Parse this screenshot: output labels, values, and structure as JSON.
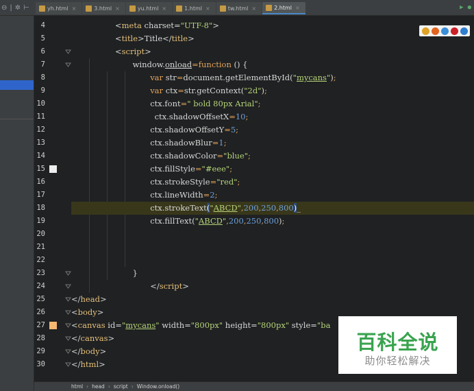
{
  "tabs": [
    {
      "label": "yh.html",
      "active": false
    },
    {
      "label": "3.html",
      "active": false
    },
    {
      "label": "yu.html",
      "active": false
    },
    {
      "label": "1.html",
      "active": false
    },
    {
      "label": "tw.html",
      "active": false
    },
    {
      "label": "2.html",
      "active": true
    }
  ],
  "gutter": {
    "line_numbers": [
      "4",
      "5",
      "6",
      "7",
      "8",
      "9",
      "10",
      "11",
      "12",
      "13",
      "14",
      "15",
      "16",
      "17",
      "18",
      "19",
      "20",
      "21",
      "22",
      "23",
      "24",
      "25",
      "26",
      "27",
      "28",
      "29",
      "30"
    ]
  },
  "code": {
    "lines": [
      {
        "indent": 10,
        "tokens": [
          {
            "t": "<",
            "c": "plain"
          },
          {
            "t": "meta",
            "c": "tag"
          },
          {
            "t": " charset=",
            "c": "plain"
          },
          {
            "t": "\"UTF-8\"",
            "c": "str"
          },
          {
            "t": ">",
            "c": "plain"
          }
        ]
      },
      {
        "indent": 10,
        "tokens": [
          {
            "t": "<",
            "c": "plain"
          },
          {
            "t": "title",
            "c": "tag"
          },
          {
            "t": ">Title</",
            "c": "plain"
          },
          {
            "t": "title",
            "c": "tag"
          },
          {
            "t": ">",
            "c": "plain"
          }
        ]
      },
      {
        "indent": 10,
        "tokens": [
          {
            "t": "<",
            "c": "plain"
          },
          {
            "t": "script",
            "c": "tag"
          },
          {
            "t": ">",
            "c": "plain"
          }
        ]
      },
      {
        "indent": 14,
        "tokens": [
          {
            "t": "window.",
            "c": "plain"
          },
          {
            "t": "onload",
            "c": "plain ul"
          },
          {
            "t": "=",
            "c": "op"
          },
          {
            "t": "function",
            "c": "kw"
          },
          {
            "t": " () {",
            "c": "plain"
          }
        ]
      },
      {
        "indent": 18,
        "tokens": [
          {
            "t": "var",
            "c": "kw"
          },
          {
            "t": " str",
            "c": "plain"
          },
          {
            "t": "=",
            "c": "op"
          },
          {
            "t": "document.getElementById(",
            "c": "plain"
          },
          {
            "t": "\"",
            "c": "str"
          },
          {
            "t": "mycans",
            "c": "str ul"
          },
          {
            "t": "\"",
            "c": "str"
          },
          {
            "t": ")",
            "c": "plain"
          },
          {
            "t": ";",
            "c": "op"
          }
        ]
      },
      {
        "indent": 18,
        "tokens": [
          {
            "t": "var",
            "c": "kw"
          },
          {
            "t": " ctx",
            "c": "plain"
          },
          {
            "t": "=",
            "c": "op"
          },
          {
            "t": "str.getContext(",
            "c": "plain"
          },
          {
            "t": "\"2d\"",
            "c": "str"
          },
          {
            "t": ")",
            "c": "plain"
          },
          {
            "t": ";",
            "c": "op"
          }
        ]
      },
      {
        "indent": 18,
        "tokens": [
          {
            "t": "ctx.font",
            "c": "plain"
          },
          {
            "t": "=",
            "c": "op"
          },
          {
            "t": "\" bold 80px Arial\"",
            "c": "str"
          },
          {
            "t": ";",
            "c": "op"
          }
        ]
      },
      {
        "indent": 19,
        "tokens": [
          {
            "t": "ctx.shadowOffsetX",
            "c": "plain"
          },
          {
            "t": "=",
            "c": "op"
          },
          {
            "t": "10",
            "c": "num"
          },
          {
            "t": ";",
            "c": "op"
          }
        ]
      },
      {
        "indent": 18,
        "tokens": [
          {
            "t": "ctx.shadowOffsetY",
            "c": "plain"
          },
          {
            "t": "=",
            "c": "op"
          },
          {
            "t": "5",
            "c": "num"
          },
          {
            "t": ";",
            "c": "op"
          }
        ]
      },
      {
        "indent": 18,
        "tokens": [
          {
            "t": "ctx.shadowBlur",
            "c": "plain"
          },
          {
            "t": "=",
            "c": "op"
          },
          {
            "t": "1",
            "c": "num"
          },
          {
            "t": ";",
            "c": "op"
          }
        ]
      },
      {
        "indent": 18,
        "tokens": [
          {
            "t": "ctx.shadowColor",
            "c": "plain"
          },
          {
            "t": "=",
            "c": "op"
          },
          {
            "t": "\"blue\"",
            "c": "str"
          },
          {
            "t": ";",
            "c": "op"
          }
        ]
      },
      {
        "indent": 18,
        "tokens": [
          {
            "t": "ctx.fillStyle",
            "c": "plain"
          },
          {
            "t": "=",
            "c": "op"
          },
          {
            "t": "\"#eee\"",
            "c": "str"
          },
          {
            "t": ";",
            "c": "op"
          }
        ]
      },
      {
        "indent": 18,
        "tokens": [
          {
            "t": "ctx.strokeStyle",
            "c": "plain"
          },
          {
            "t": "=",
            "c": "op"
          },
          {
            "t": "\"red\"",
            "c": "str"
          },
          {
            "t": ";",
            "c": "op"
          }
        ]
      },
      {
        "indent": 18,
        "tokens": [
          {
            "t": "ctx.lineWidth",
            "c": "plain"
          },
          {
            "t": "=",
            "c": "op"
          },
          {
            "t": "2",
            "c": "num"
          },
          {
            "t": ";",
            "c": "op"
          }
        ]
      },
      {
        "indent": 18,
        "current": true,
        "tokens": [
          {
            "t": "ctx.strokeText",
            "c": "plain"
          },
          {
            "t": "(",
            "c": "plain match"
          },
          {
            "t": "\"",
            "c": "str"
          },
          {
            "t": "ABCD",
            "c": "str ul"
          },
          {
            "t": "\"",
            "c": "str"
          },
          {
            "t": ",",
            "c": "op"
          },
          {
            "t": "200",
            "c": "num"
          },
          {
            "t": ",",
            "c": "op"
          },
          {
            "t": "250",
            "c": "num"
          },
          {
            "t": ",",
            "c": "op"
          },
          {
            "t": "800",
            "c": "num"
          },
          {
            "t": ")",
            "c": "plain match"
          },
          {
            "t": "_",
            "c": "plain"
          }
        ]
      },
      {
        "indent": 18,
        "tokens": [
          {
            "t": "ctx.fillText(",
            "c": "plain"
          },
          {
            "t": "\"",
            "c": "str"
          },
          {
            "t": "ABCD",
            "c": "str ul"
          },
          {
            "t": "\"",
            "c": "str"
          },
          {
            "t": ",",
            "c": "op"
          },
          {
            "t": "200",
            "c": "num"
          },
          {
            "t": ",",
            "c": "op"
          },
          {
            "t": "250",
            "c": "num"
          },
          {
            "t": ",",
            "c": "op"
          },
          {
            "t": "800",
            "c": "num"
          },
          {
            "t": ")",
            "c": "plain"
          },
          {
            "t": ";",
            "c": "op"
          }
        ]
      },
      {
        "indent": 0,
        "tokens": []
      },
      {
        "indent": 0,
        "tokens": []
      },
      {
        "indent": 0,
        "tokens": []
      },
      {
        "indent": 14,
        "tokens": [
          {
            "t": "}",
            "c": "plain"
          }
        ]
      },
      {
        "indent": 18,
        "tokens": [
          {
            "t": "</",
            "c": "plain"
          },
          {
            "t": "script",
            "c": "tag"
          },
          {
            "t": ">",
            "c": "plain"
          }
        ]
      },
      {
        "indent": 0,
        "tokens": [
          {
            "t": "</",
            "c": "plain"
          },
          {
            "t": "head",
            "c": "tag"
          },
          {
            "t": ">",
            "c": "plain"
          }
        ]
      },
      {
        "indent": 0,
        "tokens": [
          {
            "t": "<",
            "c": "plain"
          },
          {
            "t": "body",
            "c": "tag"
          },
          {
            "t": ">",
            "c": "plain"
          }
        ]
      },
      {
        "indent": 0,
        "tokens": [
          {
            "t": "<",
            "c": "plain"
          },
          {
            "t": "canvas",
            "c": "tag"
          },
          {
            "t": " id=",
            "c": "plain"
          },
          {
            "t": "\"",
            "c": "str"
          },
          {
            "t": "mycans",
            "c": "str ul"
          },
          {
            "t": "\"",
            "c": "str"
          },
          {
            "t": " width=",
            "c": "plain"
          },
          {
            "t": "\"800px\"",
            "c": "str"
          },
          {
            "t": " height=",
            "c": "plain"
          },
          {
            "t": "\"800px\"",
            "c": "str"
          },
          {
            "t": " style=",
            "c": "plain"
          },
          {
            "t": "\"ba",
            "c": "str"
          }
        ]
      },
      {
        "indent": 0,
        "tokens": [
          {
            "t": "</",
            "c": "plain"
          },
          {
            "t": "canvas",
            "c": "tag"
          },
          {
            "t": ">",
            "c": "plain"
          }
        ]
      },
      {
        "indent": 0,
        "tokens": [
          {
            "t": "</",
            "c": "plain"
          },
          {
            "t": "body",
            "c": "tag"
          },
          {
            "t": ">",
            "c": "plain"
          }
        ]
      },
      {
        "indent": 0,
        "tokens": [
          {
            "t": "</",
            "c": "plain"
          },
          {
            "t": "html",
            "c": "tag"
          },
          {
            "t": ">",
            "c": "plain"
          }
        ]
      }
    ]
  },
  "browser_icons": [
    {
      "name": "chrome-icon",
      "color": "#e0a325"
    },
    {
      "name": "firefox-icon",
      "color": "#e2641f"
    },
    {
      "name": "safari-icon",
      "color": "#3a8fd9"
    },
    {
      "name": "opera-icon",
      "color": "#cc1f26"
    },
    {
      "name": "ie-icon",
      "color": "#2f7fd0"
    }
  ],
  "breadcrumb": [
    "html",
    "head",
    "script",
    "Window.onload()"
  ],
  "watermark": {
    "title": "百科全说",
    "subtitle": "助你轻松解决"
  },
  "colors": {
    "background": "#1f2122",
    "keyword": "#e6a45b",
    "string": "#b7d37a",
    "number": "#6d9fdb",
    "tag": "#e6c07b",
    "current_line": "#38371a"
  }
}
